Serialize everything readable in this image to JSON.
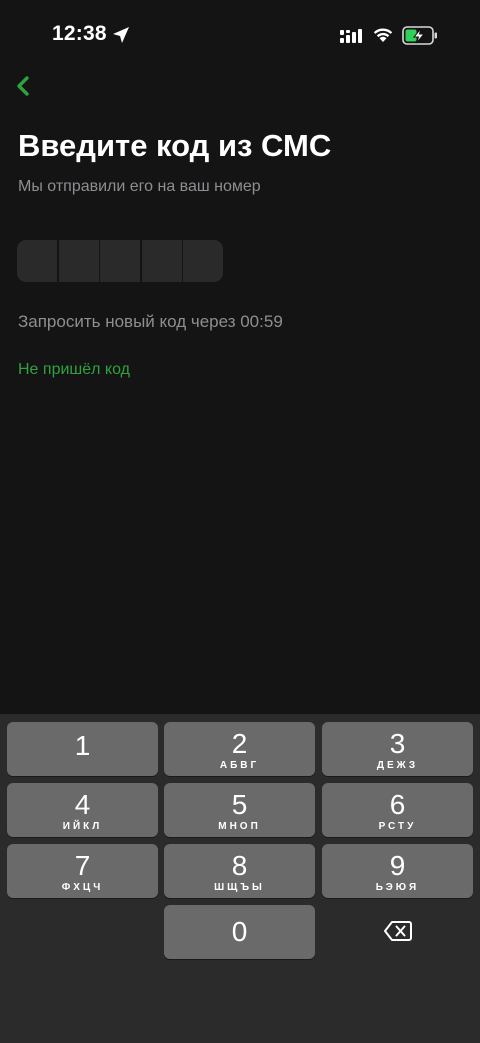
{
  "status_bar": {
    "time": "12:38",
    "icons": [
      "location-arrow-icon",
      "cellular-signal-icon",
      "wifi-icon",
      "battery-charging-icon"
    ]
  },
  "header": {
    "back_icon": "chevron-left-icon",
    "title": "Введите код из СМС",
    "subtitle": "Мы отправили его на ваш номер"
  },
  "code_input": {
    "cells": [
      "",
      "",
      "",
      "",
      ""
    ]
  },
  "resend": {
    "text": "Запросить новый код через 00:59"
  },
  "links": {
    "not_received": "Не пришёл код"
  },
  "keypad": {
    "keys": [
      {
        "digit": "1",
        "letters": ""
      },
      {
        "digit": "2",
        "letters": "АБВГ"
      },
      {
        "digit": "3",
        "letters": "ДЕЖЗ"
      },
      {
        "digit": "4",
        "letters": "ИЙКЛ"
      },
      {
        "digit": "5",
        "letters": "МНОП"
      },
      {
        "digit": "6",
        "letters": "РСТУ"
      },
      {
        "digit": "7",
        "letters": "ФХЦЧ"
      },
      {
        "digit": "8",
        "letters": "ШЩЪЫ"
      },
      {
        "digit": "9",
        "letters": "ЬЭЮЯ"
      },
      {
        "digit": "0",
        "letters": ""
      }
    ],
    "delete_icon": "backspace-icon"
  },
  "colors": {
    "background": "#141414",
    "accent": "#2fa13f",
    "muted_text": "#8e8e93",
    "key_bg": "#6a6a6a",
    "keypad_bg": "#2b2b2b"
  }
}
